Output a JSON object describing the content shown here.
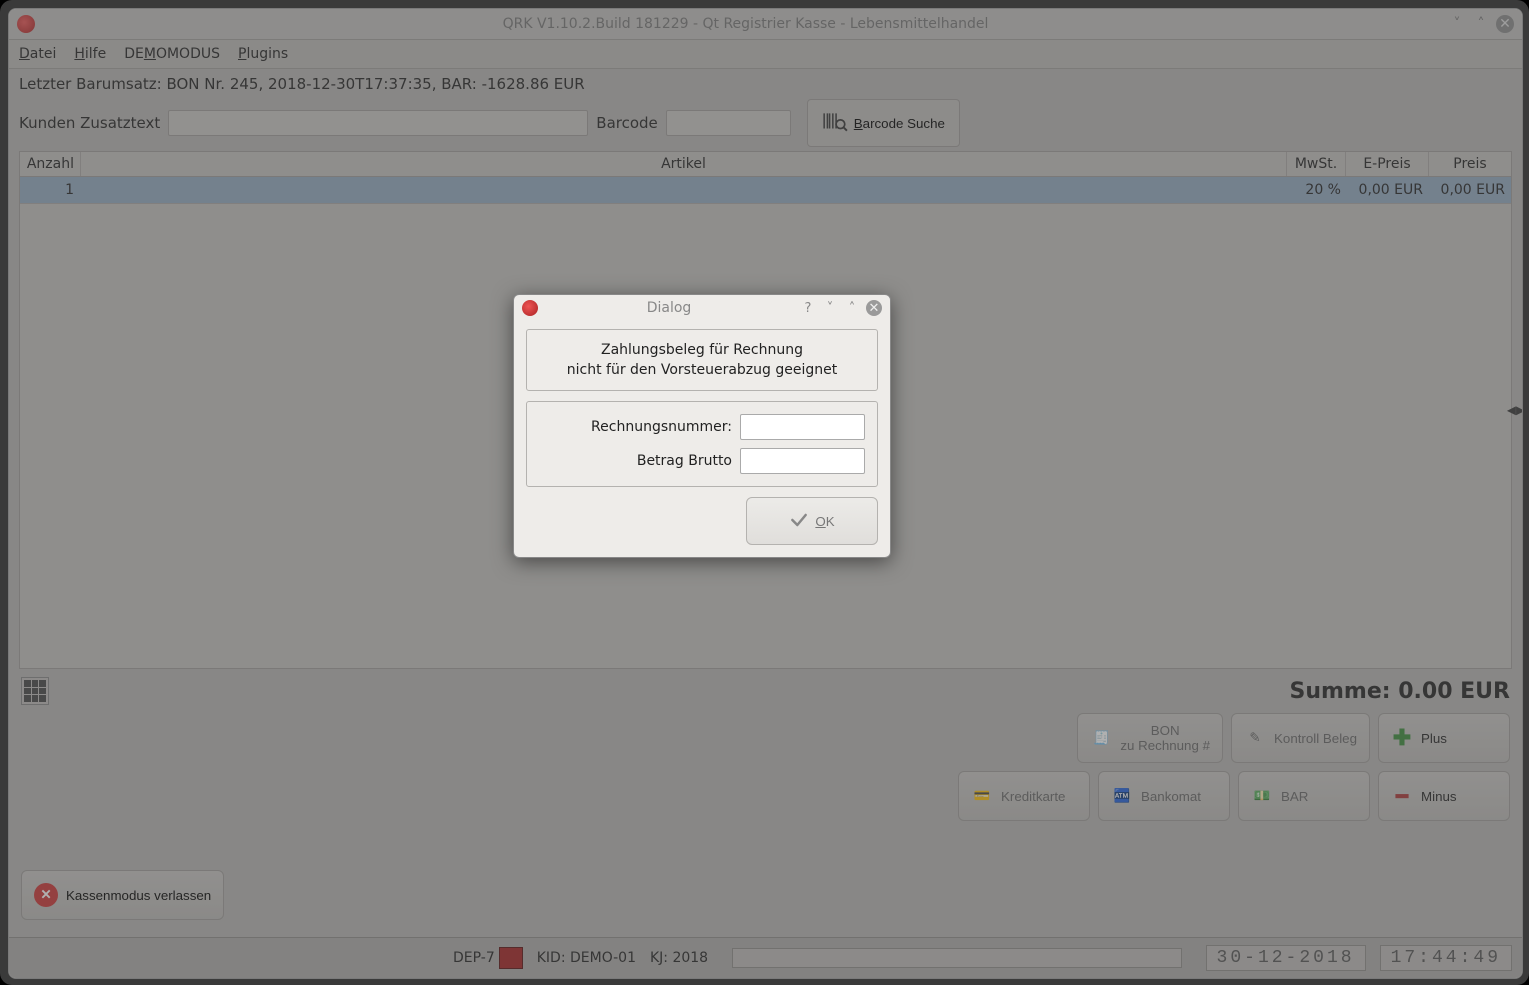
{
  "title": "QRK V1.10.2.Build 181229 - Qt Registrier Kasse - Lebensmittelhandel",
  "menu": {
    "datei": "Datei",
    "hilfe": "Hilfe",
    "demo": "DEMOMODUS",
    "plugins": "Plugins"
  },
  "last_transaction": "Letzter Barumsatz: BON Nr. 245, 2018-12-30T17:37:35, BAR: -1628.86 EUR",
  "labels": {
    "customer_text": "Kunden Zusatztext",
    "barcode": "Barcode",
    "barcode_search": "Barcode Suche"
  },
  "table": {
    "headers": {
      "anzahl": "Anzahl",
      "artikel": "Artikel",
      "mwst": "MwSt.",
      "epreis": "E-Preis",
      "preis": "Preis"
    },
    "rows": [
      {
        "anzahl": "1",
        "artikel": "",
        "mwst": "20 %",
        "epreis": "0,00 EUR",
        "preis": "0,00 EUR"
      }
    ]
  },
  "sum_label": "Summe: 0.00 EUR",
  "buttons": {
    "bon_line1": "BON",
    "bon_line2": "zu Rechnung #",
    "kontroll": "Kontroll Beleg",
    "plus": "Plus",
    "kredit": "Kreditkarte",
    "bankomat": "Bankomat",
    "bar": "BAR",
    "minus": "Minus",
    "leave_line1": "Kassenmodus",
    "leave_line2": "verlassen"
  },
  "status": {
    "dep": "DEP-7",
    "kid": "KID: DEMO-01",
    "kj": "KJ: 2018",
    "date": "30-12-2018",
    "time": "17:44:49"
  },
  "dialog": {
    "title": "Dialog",
    "line1": "Zahlungsbeleg für Rechnung",
    "line2": "nicht für den Vorsteuerabzug geeignet",
    "field1": "Rechnungsnummer:",
    "field2": "Betrag Brutto",
    "ok": "OK"
  }
}
